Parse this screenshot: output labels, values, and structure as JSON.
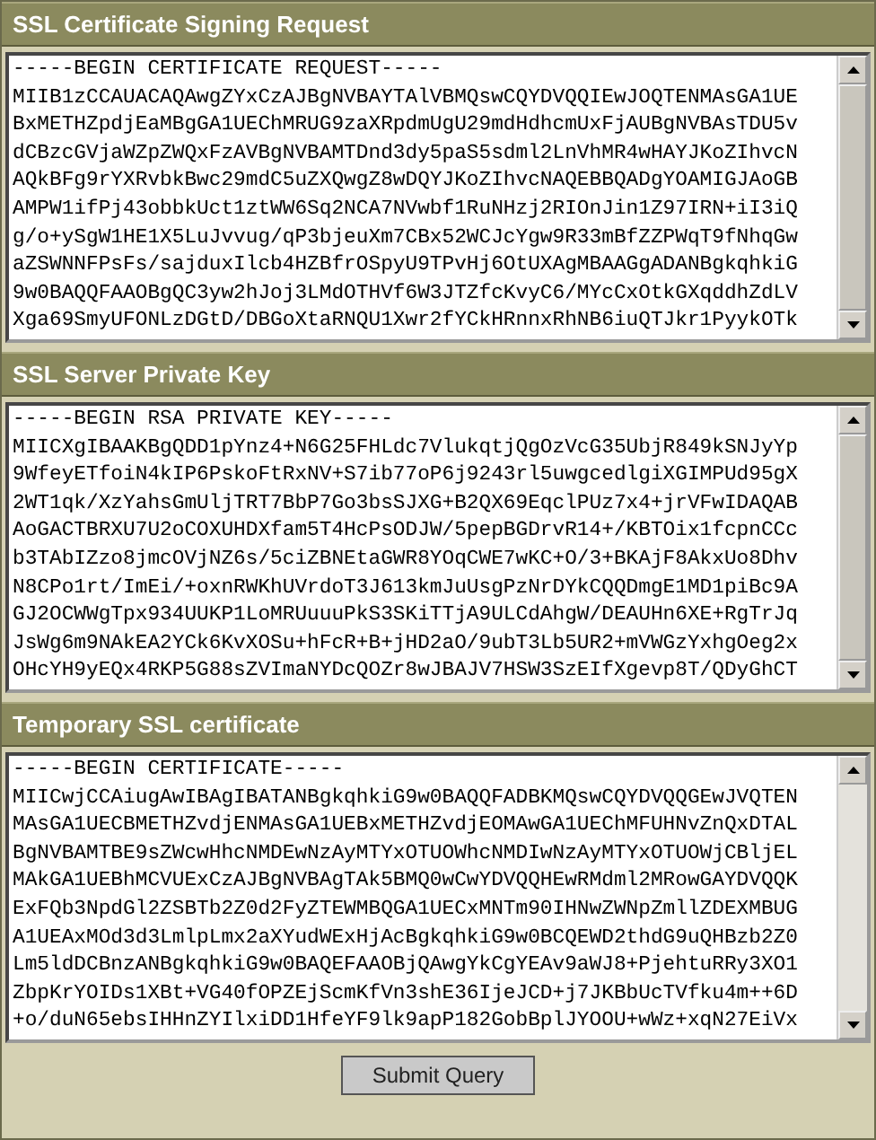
{
  "sections": [
    {
      "title": "SSL Certificate Signing Request",
      "lines": [
        "-----BEGIN CERTIFICATE REQUEST-----",
        "MIIB1zCCAUACAQAwgZYxCzAJBgNVBAYTAlVBMQswCQYDVQQIEwJOQTENMAsGA1UE",
        "BxMETHZpdjEaMBgGA1UEChMRUG9zaXRpdmUgU29mdHdhcmUxFjAUBgNVBAsTDU5v",
        "dCBzcGVjaWZpZWQxFzAVBgNVBAMTDnd3dy5paS5sdml2LnVhMR4wHAYJKoZIhvcN",
        "AQkBFg9rYXRvbkBwc29mdC5uZXQwgZ8wDQYJKoZIhvcNAQEBBQADgYOAMIGJAoGB",
        "AMPW1ifPj43obbkUct1ztWW6Sq2NCA7NVwbf1RuNHzj2RIOnJin1Z97IRN+iI3iQ",
        "g/o+ySgW1HE1X5LuJvvug/qP3bjeuXm7CBx52WCJcYgw9R33mBfZZPWqT9fNhqGw",
        "aZSWNNFPsFs/sajduxIlcb4HZBfrOSpyU9TPvHj6OtUXAgMBAAGgADANBgkqhkiG",
        "9w0BAQQFAAOBgQC3yw2hJoj3LMdOTHVf6W3JTZfcKvyC6/MYcCxOtkGXqddhZdLV",
        "Xga69SmyUFONLzDGtD/DBGoXtaRNQU1Xwr2fYCkHRnnxRhNB6iuQTJkr1PyykOTk"
      ]
    },
    {
      "title": "SSL Server Private Key",
      "lines": [
        "-----BEGIN RSA PRIVATE KEY-----",
        "MIICXgIBAAKBgQDD1pYnz4+N6G25FHLdc7VlukqtjQgOzVcG35UbjR849kSNJyYp",
        "9WfeyETfoiN4kIP6PskoFtRxNV+S7ib77oP6j9243rl5uwgcedlgiXGIMPUd95gX",
        "2WT1qk/XzYahsGmUljTRT7BbP7Go3bsSJXG+B2QX69EqclPUz7x4+jrVFwIDAQAB",
        "AoGACTBRXU7U2oCOXUHDXfam5T4HcPsODJW/5pepBGDrvR14+/KBTOix1fcpnCCc",
        "b3TAbIZzo8jmcOVjNZ6s/5ciZBNEtaGWR8YOqCWE7wKC+O/3+BKAjF8AkxUo8Dhv",
        "N8CPo1rt/ImEi/+oxnRWKhUVrdoT3J613kmJuUsgPzNrDYkCQQDmgE1MD1piBc9A",
        "GJ2OCWWgTpx934UUKP1LoMRUuuuPkS3SKiTTjA9ULCdAhgW/DEAUHn6XE+RgTrJq",
        "JsWg6m9NAkEA2YCk6KvXOSu+hFcR+B+jHD2aO/9ubT3Lb5UR2+mVWGzYxhgOeg2x",
        "OHcYH9yEQx4RKP5G88sZVImaNYDcQOZr8wJBAJV7HSW3SzEIfXgevp8T/QDyGhCT"
      ]
    },
    {
      "title": "Temporary SSL certificate",
      "lines": [
        "-----BEGIN CERTIFICATE-----",
        "MIICwjCCAiugAwIBAgIBATANBgkqhkiG9w0BAQQFADBKMQswCQYDVQQGEwJVQTEN",
        "MAsGA1UECBMETHZvdjENMAsGA1UEBxMETHZvdjEOMAwGA1UEChMFUHNvZnQxDTAL",
        "BgNVBAMTBE9sZWcwHhcNMDEwNzAyMTYxOTUOWhcNMDIwNzAyMTYxOTUOWjCBljEL",
        "MAkGA1UEBhMCVUExCzAJBgNVBAgTAk5BMQ0wCwYDVQQHEwRMdml2MRowGAYDVQQK",
        "ExFQb3NpdGl2ZSBTb2Z0d2FyZTEWMBQGA1UECxMNTm90IHNwZWNpZmllZDEXMBUG",
        "A1UEAxMOd3d3LmlpLmx2aXYudWExHjAcBgkqhkiG9w0BCQEWD2thdG9uQHBzb2Z0",
        "Lm5ldDCBnzANBgkqhkiG9w0BAQEFAAOBjQAwgYkCgYEAv9aWJ8+PjehtuRRy3XO1",
        "ZbpKrYOIDs1XBt+VG40fOPZEjScmKfVn3shE36IjeJCD+j7JKBbUcTVfku4m++6D",
        "+o/duN65ebsIHHnZYIlxiDD1HfeYF9lk9apP182GobBplJYOOU+wWz+xqN27EiVx"
      ]
    }
  ],
  "submit": "Submit Query"
}
